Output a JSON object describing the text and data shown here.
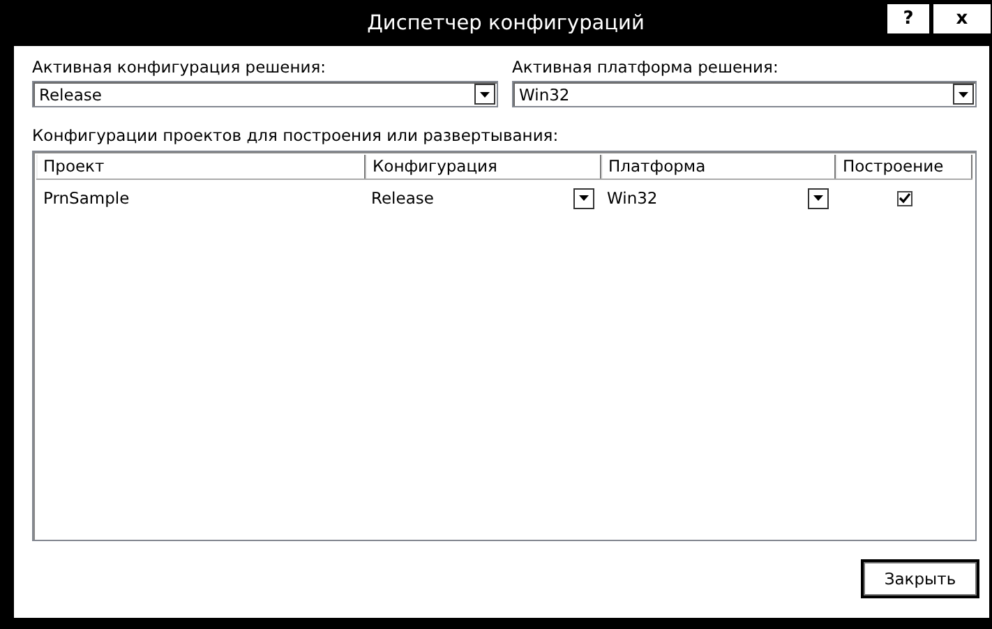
{
  "window": {
    "title": "Диспетчер конфигураций",
    "buttons": [
      {
        "kind": "help",
        "label": "?"
      },
      {
        "kind": "close",
        "label": "x"
      }
    ]
  },
  "solution_configuration": {
    "label": "Активная конфигурация решения:",
    "value": "Release"
  },
  "solution_platform": {
    "label": "Активная платформа решения:",
    "value": "Win32"
  },
  "projects": {
    "label": "Конфигурации проектов для построения или развертывания:",
    "columns": [
      "Проект",
      "Конфигурация",
      "Платформа",
      "Построение"
    ],
    "rows": [
      {
        "project": "PrnSample",
        "configuration": "Release",
        "platform": "Win32",
        "build": true
      }
    ]
  },
  "close_button": "Закрыть"
}
